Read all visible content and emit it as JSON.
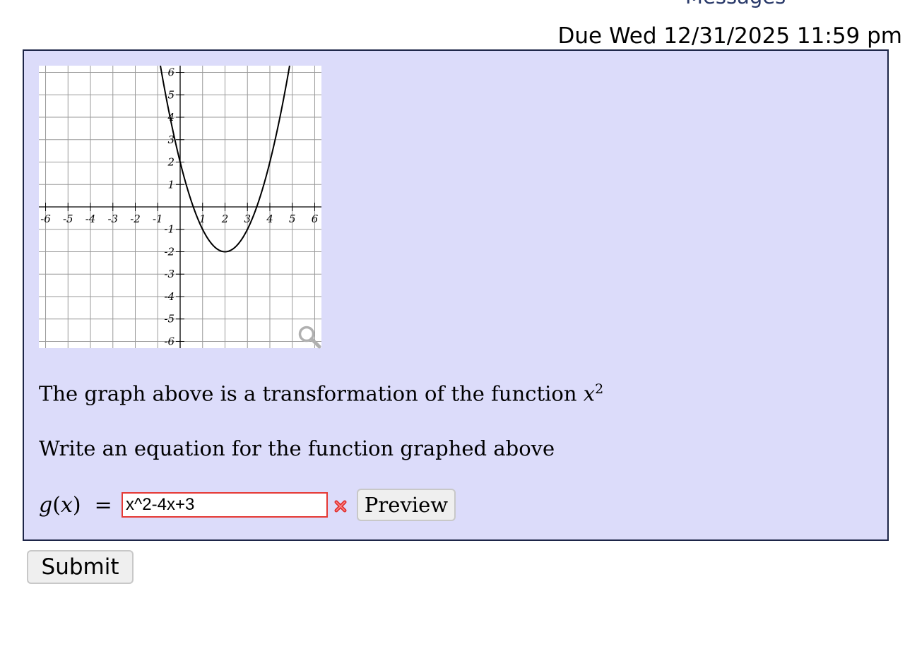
{
  "header": {
    "messages_link": "Messages",
    "due": "Due Wed 12/31/2025 11:59 pm"
  },
  "problem": {
    "text_line1": "The graph above is a transformation of the function",
    "base_function_var": "x",
    "base_function_exponent": "2",
    "text_line2": "Write an equation for the function graphed above",
    "answer_label_fn": "g",
    "answer_label_arg": "x",
    "answer_value": "x^2-4x+3",
    "preview_label": "Preview",
    "icons": {
      "zoom": "magnifier-icon",
      "error": "red-x-icon"
    },
    "colors": {
      "box_bg": "#dcdcfa",
      "box_border": "#1d2547",
      "error_border": "#e53935"
    }
  },
  "graph": {
    "x_ticks": [
      "-6",
      "-5",
      "-4",
      "-3",
      "-2",
      "-1",
      "1",
      "2",
      "3",
      "4",
      "5",
      "6"
    ],
    "y_ticks": [
      "6",
      "5",
      "4",
      "3",
      "2",
      "1",
      "-1",
      "-2",
      "-3",
      "-4",
      "-5",
      "-6"
    ],
    "xlim": [
      -6.3,
      6.3
    ],
    "ylim": [
      -6.3,
      6.3
    ],
    "curve": {
      "vertex": [
        2,
        -2
      ],
      "a": 1
    }
  },
  "footer": {
    "submit_label": "Submit"
  }
}
